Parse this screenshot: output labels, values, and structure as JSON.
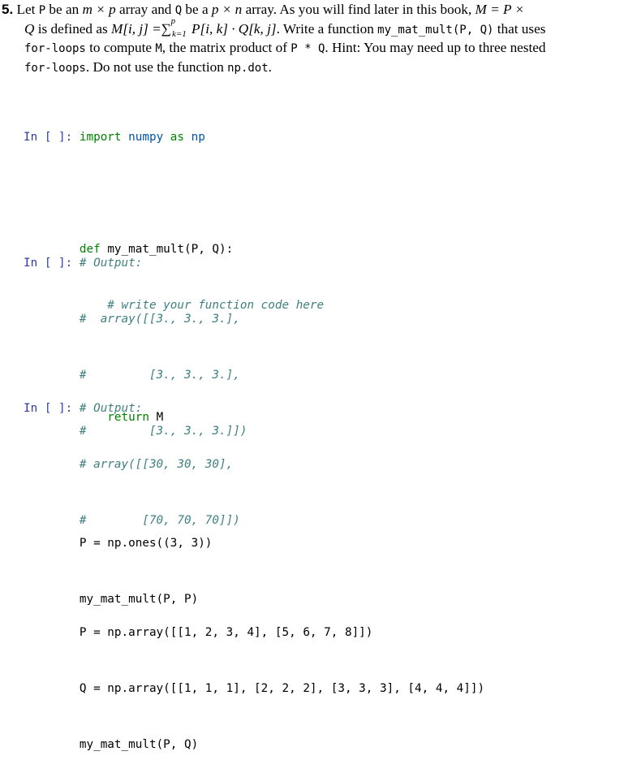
{
  "problem": {
    "number": "5.",
    "line1": {
      "t1": " Let ",
      "P": "P",
      "t2": " be an ",
      "dim1": "m × p",
      "t3": " array and ",
      "Q": "Q",
      "t4": " be a ",
      "dim2": "p × n",
      "t5": " array. As you will find later in this book, ",
      "eq": "M = P ×"
    },
    "line2": {
      "Q": "Q",
      "t1": " is defined as ",
      "lhs": "M[i, j] =",
      "sum": "∑",
      "sum_sup": "p",
      "sum_sub": "k=1",
      "rhs": " P[i, k] · Q[k, j]",
      "t2": ". Write a function ",
      "fn": "my_mat_mult(P, Q)",
      "t3": " that uses"
    },
    "line3": {
      "for": "for-loops",
      "t1": " to compute ",
      "M": "M",
      "t2": ", the matrix product of ",
      "P": "P",
      "op": " * ",
      "Q": "Q",
      "t3": ". Hint: You may need up to three nested"
    },
    "line4": {
      "for": "for-loops",
      "t1": ". Do not use the function ",
      "npdot": "np.dot",
      "t2": "."
    }
  },
  "cells": [
    {
      "prompt": "In [ ]:",
      "lines": [
        [
          "import",
          "numpy",
          "as",
          "np"
        ],
        [],
        [
          "def",
          "my_mat_mult(P, Q):"
        ],
        [
          "# write your function code here"
        ],
        [],
        [
          "return",
          "M"
        ]
      ]
    },
    {
      "prompt": "In [ ]:",
      "lines": [
        "# Output:",
        "#  array([[3., 3., 3.],",
        "#         [3., 3., 3.],",
        "#         [3., 3., 3.]])",
        "",
        "P = np.ones((3, 3))",
        "my_mat_mult(P, P)"
      ]
    },
    {
      "prompt": "In [ ]:",
      "lines": [
        "# Output:",
        "# array([[30, 30, 30],",
        "#        [70, 70, 70]])",
        "",
        "P = np.array([[1, 2, 3, 4], [5, 6, 7, 8]])",
        "Q = np.array([[1, 1, 1], [2, 2, 2], [3, 3, 3], [4, 4, 4]])",
        "my_mat_mult(P, Q)"
      ]
    }
  ]
}
